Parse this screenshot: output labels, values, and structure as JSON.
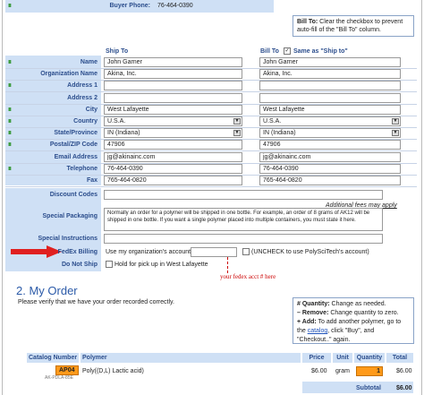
{
  "buyer": {
    "label": "Buyer Phone:",
    "value": "76-464-0390"
  },
  "bill_note": {
    "bold": "Bill To:",
    "text": " Clear the checkbox to prevent auto-fill of the \"Bill To\" column."
  },
  "columns": {
    "ship_to": "Ship To",
    "bill_to": "Bill To",
    "same_as": "Same as \"Ship to\""
  },
  "form_rows": [
    {
      "label": "Name",
      "ship": "John Garner",
      "bill": "John Garner"
    },
    {
      "label": "Organization Name",
      "ship": "Akina, Inc.",
      "bill": "Akina, Inc."
    },
    {
      "label": "Address 1",
      "ship": "",
      "bill": ""
    },
    {
      "label": "Address 2",
      "ship": "",
      "bill": ""
    },
    {
      "label": "City",
      "ship": "West Lafayette",
      "bill": "West Lafayette"
    },
    {
      "label": "Country",
      "ship": "U.S.A.",
      "bill": "U.S.A."
    },
    {
      "label": "State/Province",
      "ship": "IN   (Indiana)",
      "bill": "IN   (Indiana)"
    },
    {
      "label": "Postal/ZIP Code",
      "ship": "47906",
      "bill": "47906"
    },
    {
      "label": "Email Address",
      "ship": "jg@akinainc.com",
      "bill": "jg@akinainc.com"
    },
    {
      "label": "Telephone",
      "ship": "76-464-0390",
      "bill": "76-464-0390"
    },
    {
      "label": "Fax",
      "ship": "765-464-0820",
      "bill": "765-464-0820"
    }
  ],
  "discount": {
    "label": "Discount Codes",
    "value": ""
  },
  "fees_link": "Additional fees may apply",
  "packaging": {
    "label": "Special Packaging",
    "text": "Normally an order for a polymer will be shipped in one bottle. For example, an order of 8 grams of AK12 will be shipped in one bottle. If you want a single polymer placed into multiple containers, you must state it here."
  },
  "instructions": {
    "label": "Special Instructions",
    "value": ""
  },
  "fedex": {
    "label": "FedEx Billing",
    "text": "Use my organization's account:",
    "uncheck": "(UNCHECK to use PolySciTech's account)",
    "annotation": "your fedex acct # here"
  },
  "do_not_ship": {
    "label": "Do Not Ship",
    "text": "Hold for pick up in West Lafayette"
  },
  "order": {
    "title": "2. My Order",
    "subtitle": "Please verify that we have your order recorded correctly.",
    "help": [
      {
        "bold": "# Quantity:",
        "text": " Change as needed."
      },
      {
        "bold": "– Remove:",
        "text": " Change quantity to zero."
      },
      {
        "bold": "+ Add:",
        "text": " To add another polymer, go to the "
      },
      {
        "link": "catalog",
        "text": ", click \"Buy\", and \"Checkout..\" again."
      }
    ],
    "headers": [
      "Catalog Number",
      "Polymer",
      "Price",
      "Unit",
      "Quantity",
      "Total"
    ],
    "row": {
      "code": "AP04",
      "sub": "AK-PDLA-85E",
      "polymer": "Poly((D,L) Lactic acid)",
      "price": "$6.00",
      "unit": "gram",
      "qty": "1",
      "total": "$6.00"
    },
    "subtotal": {
      "label": "Subtotal",
      "value": "$6.00"
    }
  },
  "colors": {
    "accent": "#2b4d8c",
    "band": "#cfe0f5",
    "qty": "#ff9a1a",
    "arrow": "#e02020"
  }
}
